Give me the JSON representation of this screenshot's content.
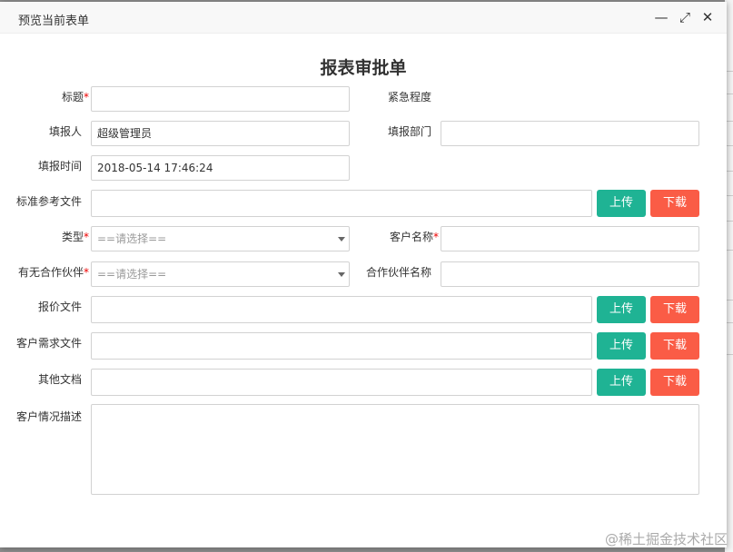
{
  "dialog": {
    "title": "预览当前表单",
    "minimize": "—",
    "maximize": "⤢",
    "close": "✕"
  },
  "form": {
    "title": "报表审批单",
    "required_mark": "*",
    "fields": {
      "title": {
        "label": "标题",
        "value": ""
      },
      "urgency": {
        "label": "紧急程度"
      },
      "reporter": {
        "label": "填报人",
        "value": "超级管理员"
      },
      "department": {
        "label": "填报部门",
        "value": ""
      },
      "report_time": {
        "label": "填报时间",
        "value": "2018-05-14 17:46:24"
      },
      "standard_file": {
        "label": "标准参考文件",
        "value": ""
      },
      "type": {
        "label": "类型",
        "placeholder": "==请选择=="
      },
      "customer_name": {
        "label": "客户名称",
        "value": ""
      },
      "has_partner": {
        "label": "有无合作伙伴",
        "placeholder": "==请选择=="
      },
      "partner_name": {
        "label": "合作伙伴名称",
        "value": ""
      },
      "quote_file": {
        "label": "报价文件",
        "value": ""
      },
      "requirement_file": {
        "label": "客户需求文件",
        "value": ""
      },
      "other_docs": {
        "label": "其他文档",
        "value": ""
      },
      "description": {
        "label": "客户情况描述",
        "value": ""
      }
    },
    "upload_label": "上传",
    "download_label": "下载"
  },
  "watermark": "@稀土掘金技术社区"
}
